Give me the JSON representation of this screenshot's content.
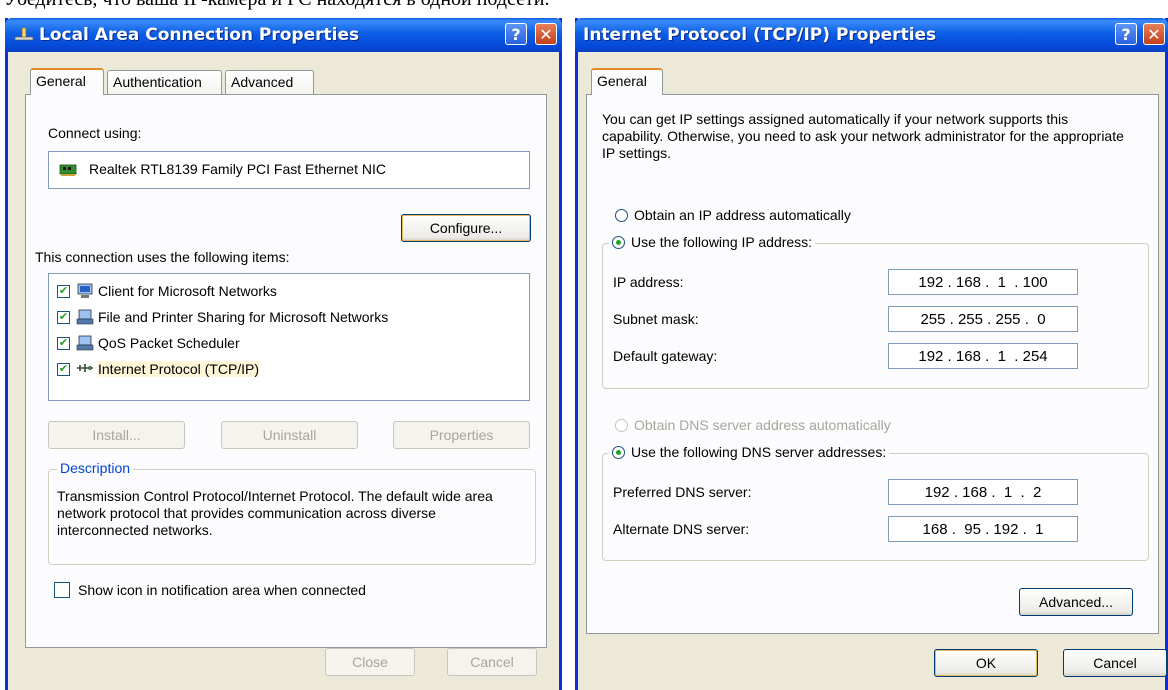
{
  "page_top_text": "Убедитесь, что ваша IP-камера и PC находятся в одной подсети.",
  "left_window": {
    "title": "Local Area Connection Properties",
    "help_glyph": "?",
    "close_glyph": "✕",
    "tabs": [
      {
        "label": "General",
        "active": true
      },
      {
        "label": "Authentication",
        "active": false
      },
      {
        "label": "Advanced",
        "active": false
      }
    ],
    "connect_using_label": "Connect using:",
    "adapter_name": "Realtek RTL8139 Family PCI Fast Ethernet NIC",
    "configure_label": "Configure...",
    "items_label": "This connection uses the following items:",
    "items": [
      {
        "label": "Client for Microsoft Networks",
        "checked": true,
        "icon": "network-client-icon"
      },
      {
        "label": "File and Printer Sharing for Microsoft Networks",
        "checked": true,
        "icon": "file-share-icon"
      },
      {
        "label": "QoS Packet Scheduler",
        "checked": true,
        "icon": "qos-icon"
      },
      {
        "label": "Internet Protocol (TCP/IP)",
        "checked": true,
        "icon": "protocol-icon",
        "selected": true
      }
    ],
    "install_label": "Install...",
    "uninstall_label": "Uninstall",
    "properties_label": "Properties",
    "description_legend": "Description",
    "description_text": "Transmission Control Protocol/Internet Protocol. The default wide area network protocol that provides communication across diverse interconnected networks.",
    "show_icon_label": "Show icon in notification area when connected",
    "show_icon_checked": false,
    "close_label": "Close",
    "cancel_label": "Cancel"
  },
  "right_window": {
    "title": "Internet Protocol (TCP/IP) Properties",
    "help_glyph": "?",
    "close_glyph": "✕",
    "tab_label": "General",
    "intro_text": "You can get IP settings assigned automatically if your network supports this capability. Otherwise, you need to ask your network administrator for the appropriate IP settings.",
    "obtain_ip_auto_label": "Obtain an IP address automatically",
    "use_following_ip_label": "Use the following IP address:",
    "ip_address_label": "IP address:",
    "ip_address_value": "192 . 168 .  1  . 100",
    "subnet_mask_label": "Subnet mask:",
    "subnet_mask_value": "255 . 255 . 255 .  0",
    "default_gateway_label": "Default gateway:",
    "default_gateway_value": "192 . 168 .  1  . 254",
    "obtain_dns_auto_label": "Obtain DNS server address automatically",
    "use_following_dns_label": "Use the following DNS server addresses:",
    "preferred_dns_label": "Preferred DNS server:",
    "preferred_dns_value": "192 . 168 .  1  .  2",
    "alternate_dns_label": "Alternate DNS server:",
    "alternate_dns_value": "168 .  95 . 192 .  1",
    "advanced_label": "Advanced...",
    "ok_label": "OK",
    "cancel_label": "Cancel"
  }
}
